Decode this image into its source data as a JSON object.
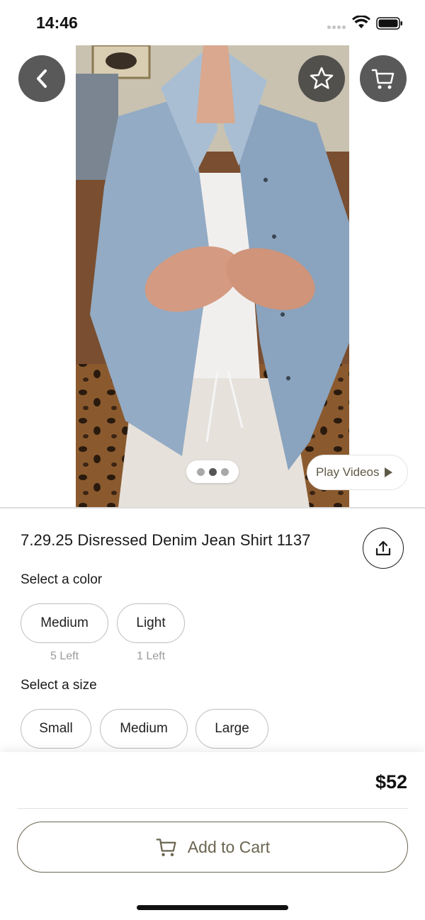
{
  "status_bar": {
    "time": "14:46"
  },
  "media": {
    "play_videos_label": "Play Videos",
    "pager": {
      "count": 3,
      "active_index": 1
    }
  },
  "product": {
    "title": "7.29.25 Disressed Denim Jean Shirt 1137",
    "color_label": "Select a color",
    "colors": [
      {
        "name": "Medium",
        "stock": "5 Left"
      },
      {
        "name": "Light",
        "stock": "1 Left"
      }
    ],
    "size_label": "Select a size",
    "sizes": [
      "Small",
      "Medium",
      "Large"
    ]
  },
  "checkout": {
    "price": "$52",
    "add_to_cart_label": "Add to Cart"
  },
  "icons": {
    "back": "chevron-left-icon",
    "favorite": "star-icon",
    "cart": "cart-icon",
    "share": "share-icon",
    "play": "play-icon"
  },
  "colors": {
    "accent": "#6b6550",
    "button_overlay": "#3c3c3c",
    "border": "#bdbdbd"
  }
}
